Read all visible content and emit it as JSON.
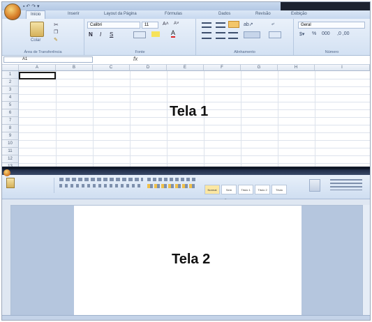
{
  "screen1": {
    "label": "Tela 1",
    "tabs": [
      "Início",
      "Inserir",
      "Layout da Página",
      "Fórmulas",
      "Dados",
      "Revisão",
      "Exibição"
    ],
    "clipboard": {
      "paste_label": "Colar",
      "group_label": "Área de Transferência"
    },
    "font": {
      "name": "Calibri",
      "size": "11",
      "group_label": "Fonte"
    },
    "alignment": {
      "group_label": "Alinhamento"
    },
    "number": {
      "format": "Geral",
      "group_label": "Número"
    },
    "formula_bar": {
      "cell_ref": "A1",
      "fx": "fx"
    },
    "columns": [
      "A",
      "B",
      "C",
      "D",
      "E",
      "F",
      "G",
      "H",
      "I"
    ],
    "rows": [
      "1",
      "2",
      "3",
      "4",
      "5",
      "6",
      "7",
      "8",
      "9",
      "10",
      "11",
      "12",
      "13"
    ]
  },
  "screen2": {
    "label": "Tela 2",
    "styles": [
      "Normal",
      "Sem Espaç.",
      "Título 1",
      "Título 2",
      "Título"
    ]
  },
  "colors": {
    "ribbon_blue": "#d3e1f3",
    "office_orange": "#d9822b",
    "selection_border": "#1a1a1a"
  },
  "icons": [
    "office-button-icon",
    "paste-icon",
    "cut-icon",
    "copy-icon",
    "format-painter-icon",
    "bold-icon",
    "italic-icon",
    "underline-icon",
    "font-color-icon",
    "align-left-icon",
    "align-center-icon",
    "align-right-icon",
    "wrap-text-icon",
    "merge-icon",
    "currency-icon",
    "percent-icon",
    "fx-icon"
  ]
}
